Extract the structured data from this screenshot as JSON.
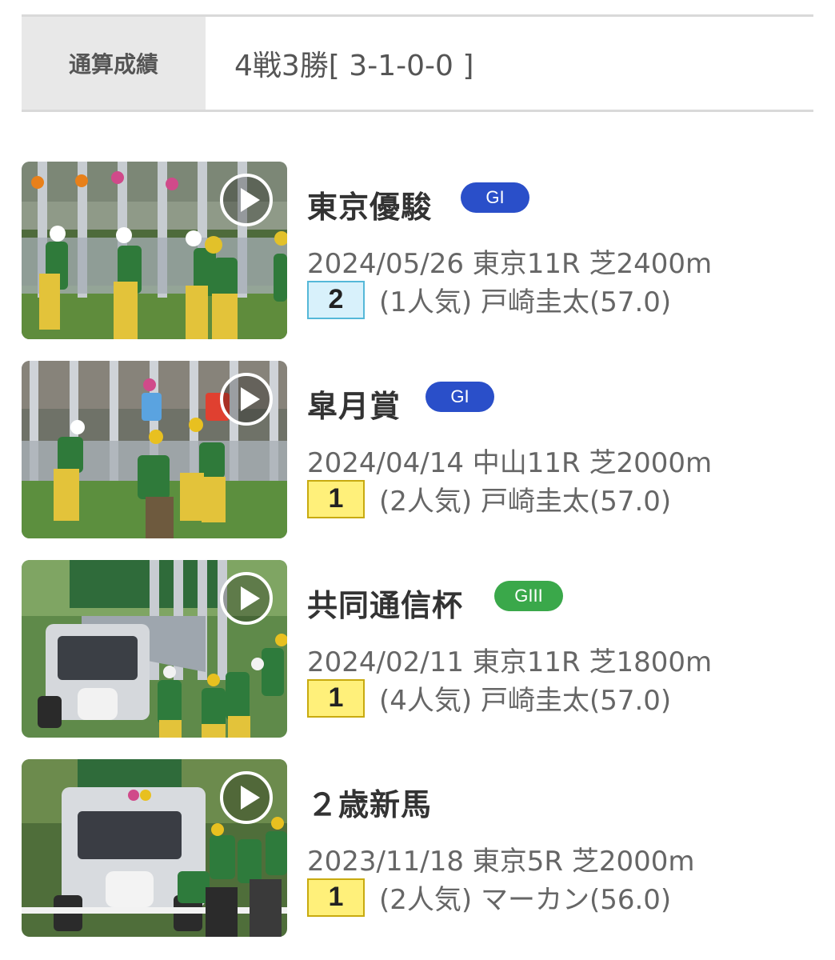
{
  "summary": {
    "label": "通算成績",
    "value": "4戦3勝[ 3-1-0-0 ]"
  },
  "races": [
    {
      "name": "東京優駿",
      "grade": "GI",
      "grade_color": "#2a4fc9",
      "info": "2024/05/26 東京11R 芝2400m",
      "place": "2",
      "detail": "(1人気) 戸崎圭太(57.0)",
      "play_icon": "play-icon"
    },
    {
      "name": "皐月賞",
      "grade": "GI",
      "grade_color": "#2a4fc9",
      "info": "2024/04/14 中山11R 芝2000m",
      "place": "1",
      "detail": "(2人気) 戸崎圭太(57.0)",
      "play_icon": "play-icon"
    },
    {
      "name": "共同通信杯",
      "grade": "GIII",
      "grade_color": "#3aa84a",
      "info": "2024/02/11 東京11R 芝1800m",
      "place": "1",
      "detail": "(4人気) 戸崎圭太(57.0)",
      "play_icon": "play-icon"
    },
    {
      "name": "２歳新馬",
      "grade": "",
      "info": "2023/11/18 東京5R 芝2000m",
      "place": "1",
      "detail": "(2人気) マーカン(56.0)",
      "play_icon": "play-icon"
    }
  ]
}
